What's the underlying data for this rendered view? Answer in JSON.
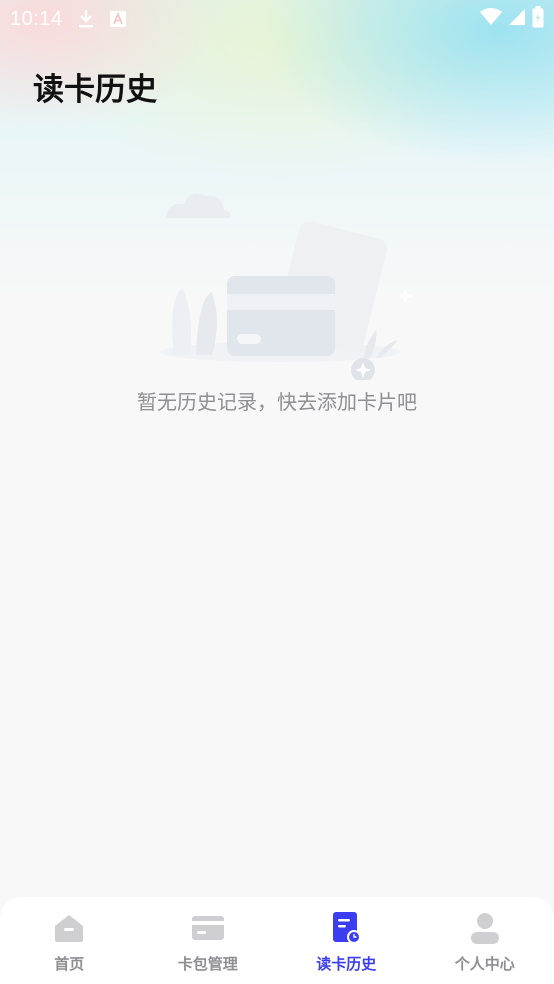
{
  "status_bar": {
    "time": "10:14",
    "icons": [
      "download-icon",
      "text-a-icon",
      "wifi-icon",
      "signal-icon",
      "battery-icon"
    ]
  },
  "header": {
    "title": "读卡历史"
  },
  "empty_state": {
    "message": "暂无历史记录，快去添加卡片吧",
    "illustration": "empty-card-illustration"
  },
  "tab_bar": {
    "active_color": "#3b3df0",
    "inactive_color": "#8e8e93",
    "tabs": [
      {
        "label": "首页",
        "icon": "home-icon",
        "active": false
      },
      {
        "label": "卡包管理",
        "icon": "card-wallet-icon",
        "active": false
      },
      {
        "label": "读卡历史",
        "icon": "read-history-icon",
        "active": true
      },
      {
        "label": "个人中心",
        "icon": "profile-icon",
        "active": false
      }
    ]
  }
}
